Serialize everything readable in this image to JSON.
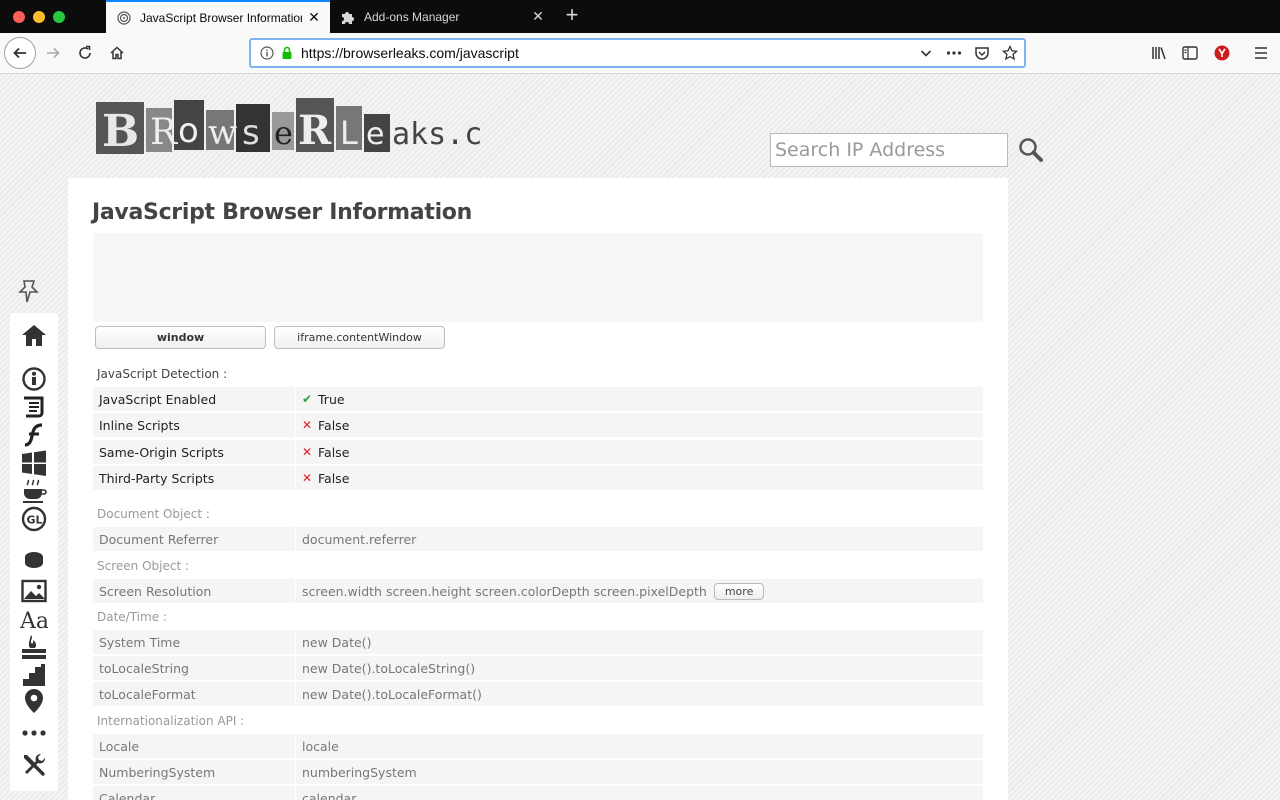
{
  "browser": {
    "tabs": [
      {
        "title": "JavaScript Browser Information",
        "active": true
      },
      {
        "title": "Add-ons Manager",
        "active": false
      }
    ],
    "url": "https://browserleaks.com/javascript"
  },
  "header": {
    "logo_text": "BrowseRLeaks.com",
    "search_placeholder": "Search IP Address"
  },
  "main": {
    "title": "JavaScript Browser Information",
    "tab_buttons": [
      "window",
      "iframe.contentWindow"
    ],
    "sections": {
      "detection": {
        "label": "JavaScript Detection :",
        "rows": [
          {
            "key": "JavaScript Enabled",
            "mark": "✔",
            "value": "True"
          },
          {
            "key": "Inline Scripts",
            "mark": "✕",
            "value": "False"
          },
          {
            "key": "Same-Origin Scripts",
            "mark": "✕",
            "value": "False"
          },
          {
            "key": "Third-Party Scripts",
            "mark": "✕",
            "value": "False"
          }
        ]
      },
      "document": {
        "label": "Document Object :",
        "rows": [
          {
            "key": "Document Referrer",
            "value": "document.referrer"
          }
        ]
      },
      "screen": {
        "label": "Screen Object :",
        "rows": [
          {
            "key": "Screen Resolution",
            "value": "screen.width screen.height screen.colorDepth screen.pixelDepth"
          }
        ],
        "more_label": "more"
      },
      "datetime": {
        "label": "Date/Time :",
        "rows": [
          {
            "key": "System Time",
            "value": "new Date()"
          },
          {
            "key": "toLocaleString",
            "value": "new Date().toLocaleString()"
          },
          {
            "key": "toLocaleFormat",
            "value": "new Date().toLocaleFormat()"
          }
        ]
      },
      "intl": {
        "label": "Internationalization API :",
        "rows": [
          {
            "key": "Locale",
            "value": "locale"
          },
          {
            "key": "NumberingSystem",
            "value": "numberingSystem"
          },
          {
            "key": "Calendar",
            "value": "calendar"
          }
        ]
      }
    }
  },
  "colors": {
    "accent": "#0a84ff",
    "ok": "#2e9e3e",
    "bad": "#e02020"
  }
}
